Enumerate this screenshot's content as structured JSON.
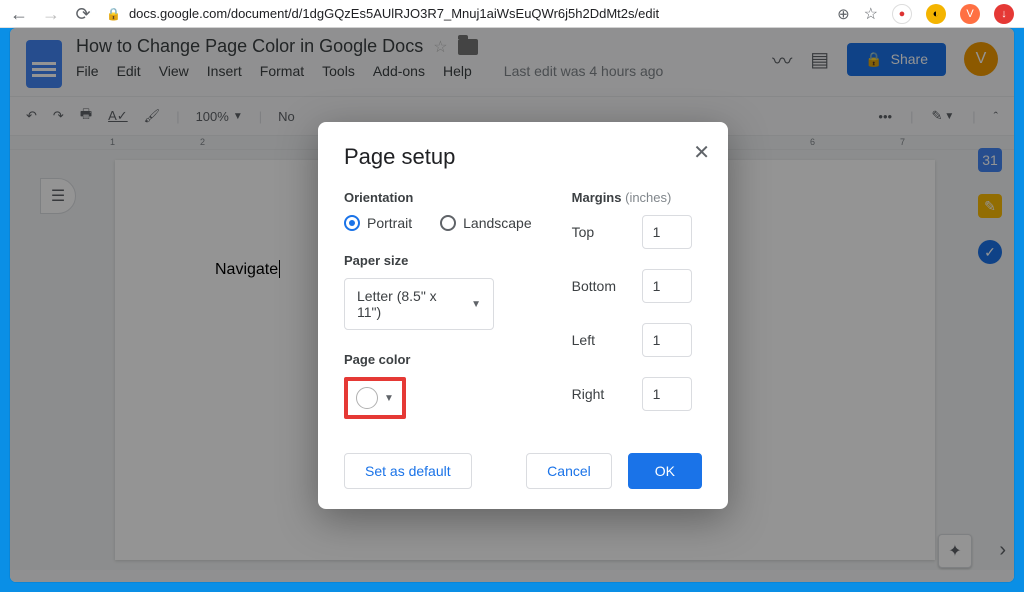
{
  "browser": {
    "url": "docs.google.com/document/d/1dgGQzEs5AUlRJO3R7_Mnuj1aiWsEuQWr6j5h2DdMt2s/edit",
    "avatar_letter": "V"
  },
  "header": {
    "doc_title": "How to Change Page Color in Google Docs",
    "menus": [
      "File",
      "Edit",
      "View",
      "Insert",
      "Format",
      "Tools",
      "Add-ons",
      "Help"
    ],
    "last_edit": "Last edit was 4 hours ago",
    "share_label": "Share",
    "avatar_letter": "V"
  },
  "toolbar": {
    "zoom": "100%",
    "style": "No"
  },
  "ruler": {
    "ticks": [
      "1",
      "2",
      "6",
      "7"
    ]
  },
  "document": {
    "body_text": "Navigate"
  },
  "dialog": {
    "title": "Page setup",
    "orientation_label": "Orientation",
    "portrait": "Portrait",
    "landscape": "Landscape",
    "paper_size_label": "Paper size",
    "paper_size_value": "Letter (8.5\" x 11\")",
    "page_color_label": "Page color",
    "margins_label": "Margins",
    "margins_unit": "(inches)",
    "top_label": "Top",
    "top_value": "1",
    "bottom_label": "Bottom",
    "bottom_value": "1",
    "left_label": "Left",
    "left_value": "1",
    "right_label": "Right",
    "right_value": "1",
    "set_default": "Set as default",
    "cancel": "Cancel",
    "ok": "OK"
  }
}
